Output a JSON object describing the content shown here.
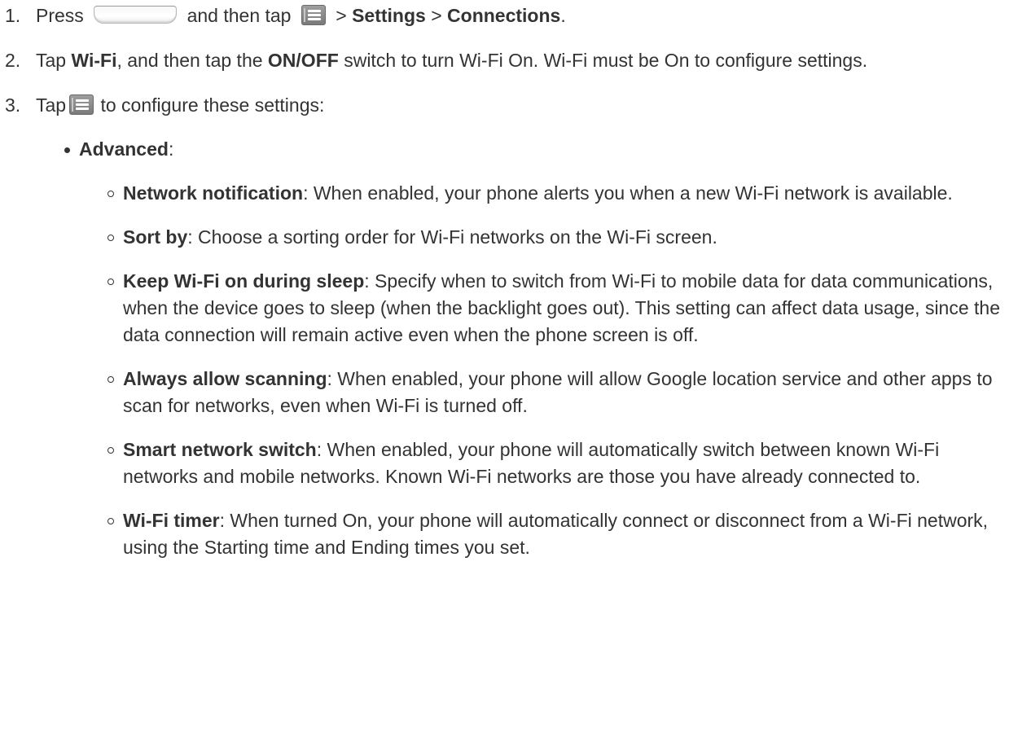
{
  "steps": {
    "one": {
      "num": "1.",
      "press": "Press",
      "then_tap": "and then tap",
      "sep1": ">",
      "settings": "Settings",
      "sep2": ">",
      "connections": "Connections",
      "end": "."
    },
    "two": {
      "num": "2.",
      "tap": "Tap",
      "wifi": "Wi-Fi",
      "mid": ", and then tap the",
      "onoff": "ON/OFF",
      "rest": "switch to turn Wi-Fi On. Wi-Fi must be On to configure settings."
    },
    "three": {
      "num": "3.",
      "tap": "Tap",
      "rest": "to configure these settings:"
    }
  },
  "advanced": {
    "label": "Advanced",
    "colon": ":"
  },
  "items": [
    {
      "term": "Network notification",
      "desc": ": When enabled, your phone alerts you when a new Wi-Fi network is available."
    },
    {
      "term": "Sort by",
      "desc": ": Choose a sorting order for Wi-Fi networks on the Wi-Fi screen."
    },
    {
      "term": "Keep Wi-Fi on during sleep",
      "desc": ": Specify when to switch from Wi-Fi to mobile data for data communications, when the device goes to sleep (when the backlight goes out). This setting can affect data usage, since the data connection will remain active even when the phone screen is off."
    },
    {
      "term": "Always allow scanning",
      "desc": ": When enabled, your phone will allow Google location service and other apps to scan for networks, even when Wi-Fi is turned off."
    },
    {
      "term": "Smart network switch",
      "desc": ": When enabled, your phone will automatically switch between known Wi-Fi networks and mobile networks. Known Wi-Fi networks are those you have already connected to."
    },
    {
      "term": "Wi-Fi timer",
      "desc": ": When turned On, your phone will automatically connect or disconnect from a Wi-Fi network, using the Starting time and Ending times you set."
    }
  ],
  "icons": {
    "home_key": "home-key-icon",
    "menu_key": "menu-key-icon"
  }
}
